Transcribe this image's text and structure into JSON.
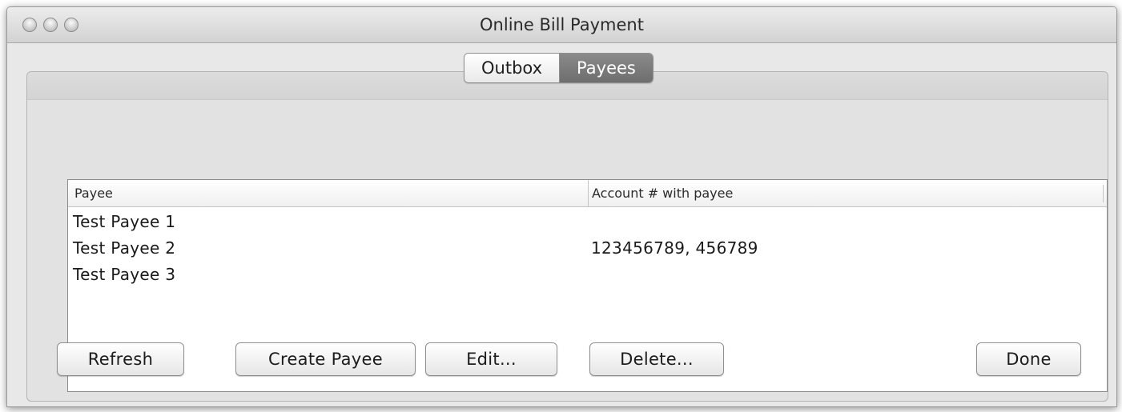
{
  "window": {
    "title": "Online Bill Payment"
  },
  "tabs": [
    {
      "label": "Outbox",
      "selected": false
    },
    {
      "label": "Payees",
      "selected": true
    }
  ],
  "table": {
    "columns": [
      "Payee",
      "Account # with payee"
    ],
    "rows": [
      {
        "payee": "Test Payee 1",
        "account": ""
      },
      {
        "payee": "Test Payee 2",
        "account": "123456789, 456789"
      },
      {
        "payee": "Test Payee 3",
        "account": ""
      }
    ]
  },
  "buttons": {
    "refresh": "Refresh",
    "create_payee": "Create Payee",
    "edit": "Edit...",
    "delete": "Delete...",
    "done": "Done"
  },
  "colors": {
    "active_tab": "#7d7d7d",
    "window_bg": "#e8e8e8"
  }
}
